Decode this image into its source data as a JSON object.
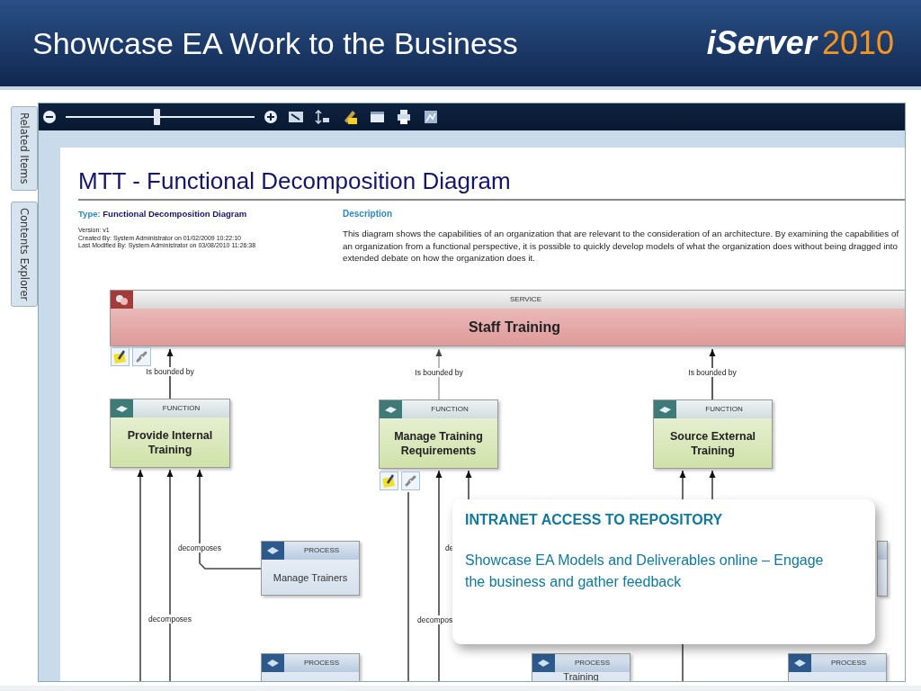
{
  "slide": {
    "title": "Showcase EA Work to the Business",
    "logo": {
      "name": "iServer",
      "year": "2010"
    }
  },
  "side_tabs": [
    {
      "label": "Related Items"
    },
    {
      "label": "Contents Explorer"
    }
  ],
  "toolbar": {
    "zoom": {
      "level": 0.48
    }
  },
  "document": {
    "title": "MTT - Functional Decomposition Diagram",
    "type_label": "Type:",
    "type_value": "Functional Decomposition Diagram",
    "version": "Version: v1",
    "created": "Created By: System Administrator on 01/02/2009 10:22:10",
    "modified": "Last Modified By: System Administrator on 03/08/2010 11:26:38",
    "description_label": "Description",
    "description": "This diagram shows the capabilities of an organization that are relevant to the consideration of an architecture. By examining the capabilities of an organization from a functional perspective, it is possible to quickly develop models of what the organization does without being dragged into extended debate on how the organization does it."
  },
  "diagram": {
    "nodes": [
      {
        "kind": "service",
        "type": "SERVICE",
        "label": "Staff Training"
      },
      {
        "kind": "function",
        "type": "FUNCTION",
        "label": "Provide Internal Training"
      },
      {
        "kind": "function",
        "type": "FUNCTION",
        "label": "Manage Training Requirements"
      },
      {
        "kind": "function",
        "type": "FUNCTION",
        "label": "Source External Training"
      },
      {
        "kind": "process",
        "type": "PROCESS",
        "label": "Manage Trainers"
      },
      {
        "kind": "process"
      },
      {
        "kind": "process",
        "type": "PROCESS"
      },
      {
        "kind": "process",
        "type": "PROCESS",
        "label": "Training"
      },
      {
        "kind": "process",
        "type": "PROCESS"
      }
    ],
    "relations": [
      {
        "label": "Is bounded by"
      },
      {
        "label": "Is bounded by"
      },
      {
        "label": "Is bounded by"
      },
      {
        "label": "decomposes"
      },
      {
        "label": "decomposes"
      },
      {
        "label": "de"
      },
      {
        "label": "decompos"
      }
    ]
  },
  "callout": {
    "heading": "INTRANET ACCESS TO REPOSITORY",
    "text": "Showcase EA Models and Deliverables online – Engage the business and gather feedback"
  }
}
